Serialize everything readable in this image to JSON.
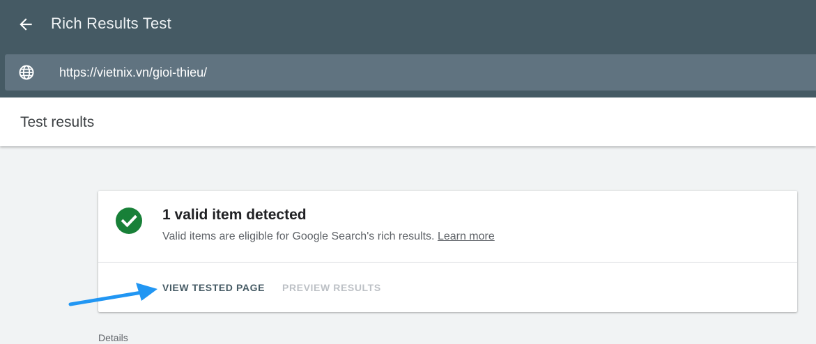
{
  "app": {
    "title": "Rich Results Test"
  },
  "url_bar": {
    "value": "https://vietnix.vn/gioi-thieu/"
  },
  "results": {
    "title": "Test results"
  },
  "card": {
    "heading": "1 valid item detected",
    "description": "Valid items are eligible for Google Search's rich results.",
    "learn_more": "Learn more",
    "view_button": "VIEW TESTED PAGE",
    "preview_button": "PREVIEW RESULTS"
  },
  "details": {
    "label": "Details"
  },
  "icons": {
    "back": "arrow-back-icon",
    "globe": "globe-icon",
    "valid": "check-circle-icon",
    "annotation": "blue-arrow-icon"
  },
  "colors": {
    "appbar": "#455a64",
    "urlbar": "#607380",
    "success": "#188038",
    "annotation_arrow": "#2196f3"
  }
}
